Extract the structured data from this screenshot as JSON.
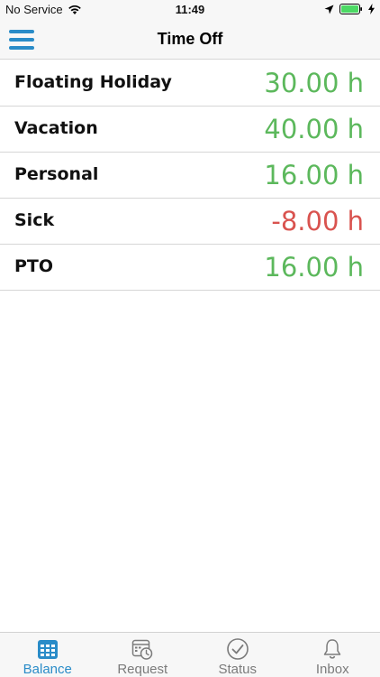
{
  "status_bar": {
    "carrier": "No Service",
    "time": "11:49"
  },
  "nav": {
    "title": "Time Off"
  },
  "balances": [
    {
      "label": "Floating Holiday",
      "value": "30.00 h",
      "color": "#5cb85c"
    },
    {
      "label": "Vacation",
      "value": "40.00 h",
      "color": "#5cb85c"
    },
    {
      "label": "Personal",
      "value": "16.00 h",
      "color": "#5cb85c"
    },
    {
      "label": "Sick",
      "value": "-8.00 h",
      "color": "#d9534f"
    },
    {
      "label": "PTO",
      "value": "16.00 h",
      "color": "#5cb85c"
    }
  ],
  "tabs": [
    {
      "label": "Balance",
      "icon": "grid-calendar-icon",
      "active": true
    },
    {
      "label": "Request",
      "icon": "calendar-clock-icon",
      "active": false
    },
    {
      "label": "Status",
      "icon": "check-circle-icon",
      "active": false
    },
    {
      "label": "Inbox",
      "icon": "bell-icon",
      "active": false
    }
  ],
  "colors": {
    "accent": "#2a8cc8",
    "inactive": "#7b7b7b"
  }
}
